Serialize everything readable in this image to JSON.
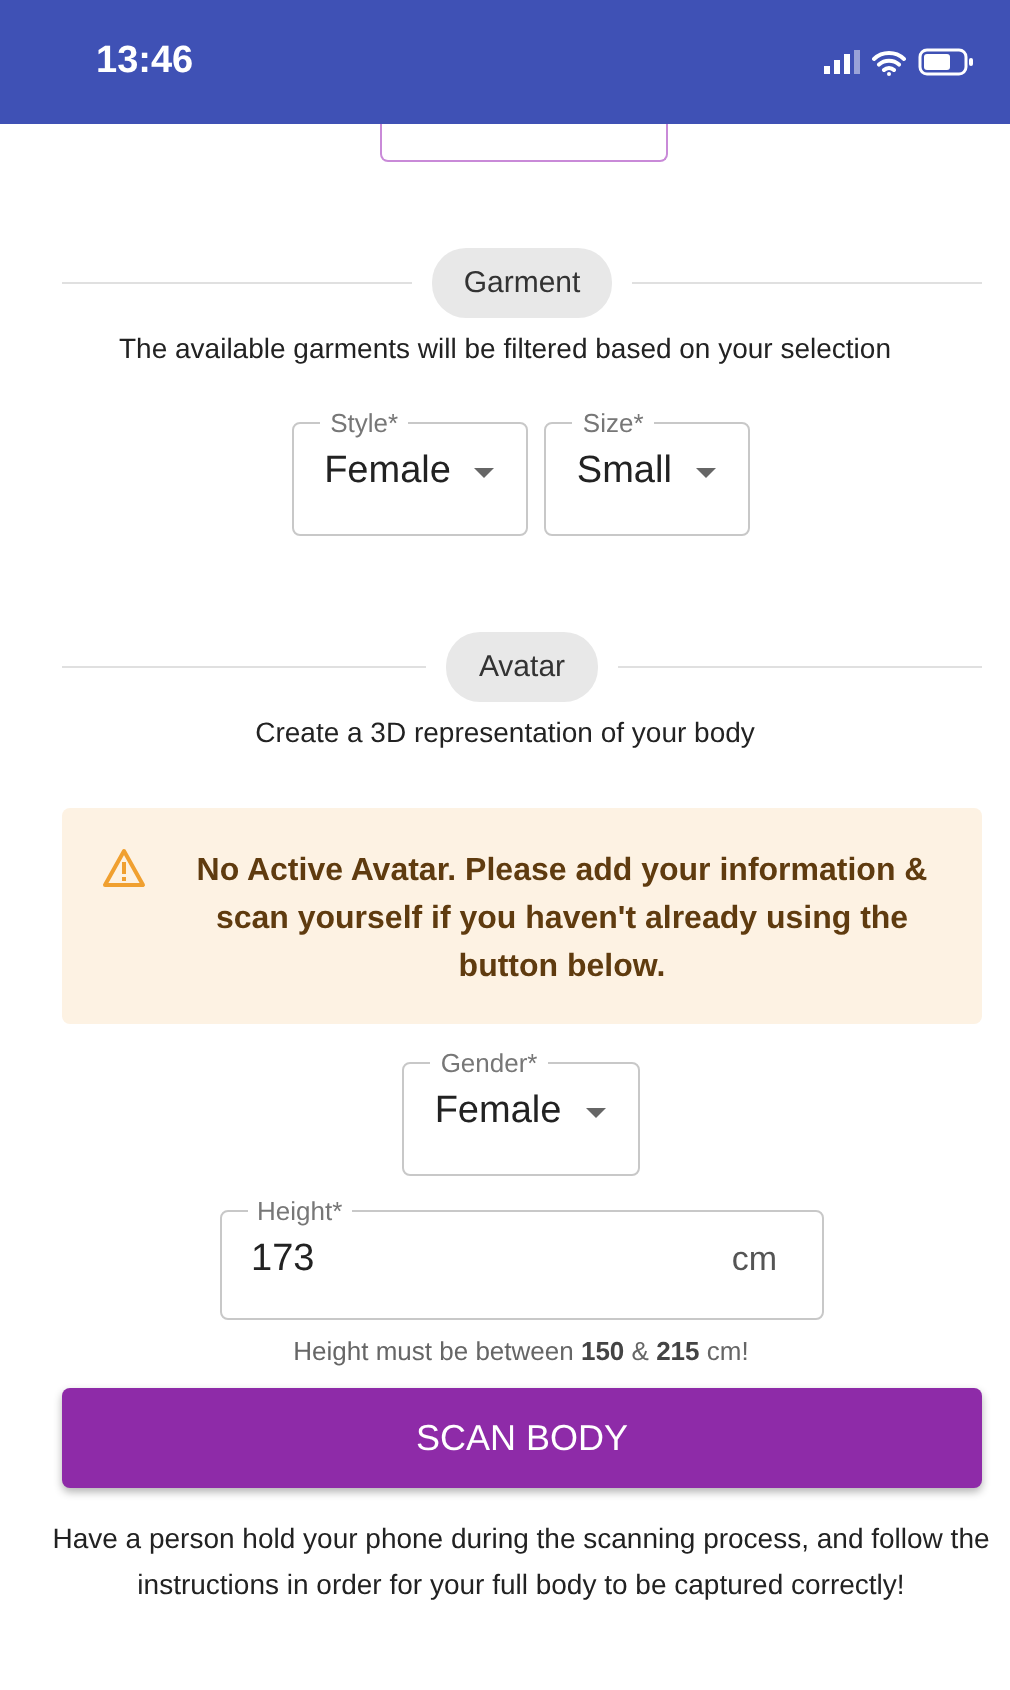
{
  "status_bar": {
    "time": "13:46"
  },
  "garment": {
    "chip": "Garment",
    "description": "The available garments will be filtered based on your selection",
    "selects": [
      {
        "label": "Style*",
        "value": "Female"
      },
      {
        "label": "Size*",
        "value": "Small"
      }
    ]
  },
  "avatar": {
    "chip": "Avatar",
    "description": "Create a 3D representation of your body",
    "alert": {
      "text": "No Active Avatar. Please add your information & scan yourself if you haven't already using the button below."
    },
    "gender": {
      "label": "Gender*",
      "value": "Female"
    },
    "height": {
      "label": "Height*",
      "value": "173",
      "unit": "cm",
      "helper": "Height must be between **150** & **215** cm!"
    },
    "button": "SCAN BODY",
    "note": "Have a person hold your phone during the scanning process, and follow the instructions in order for your full body to be captured correctly!"
  }
}
